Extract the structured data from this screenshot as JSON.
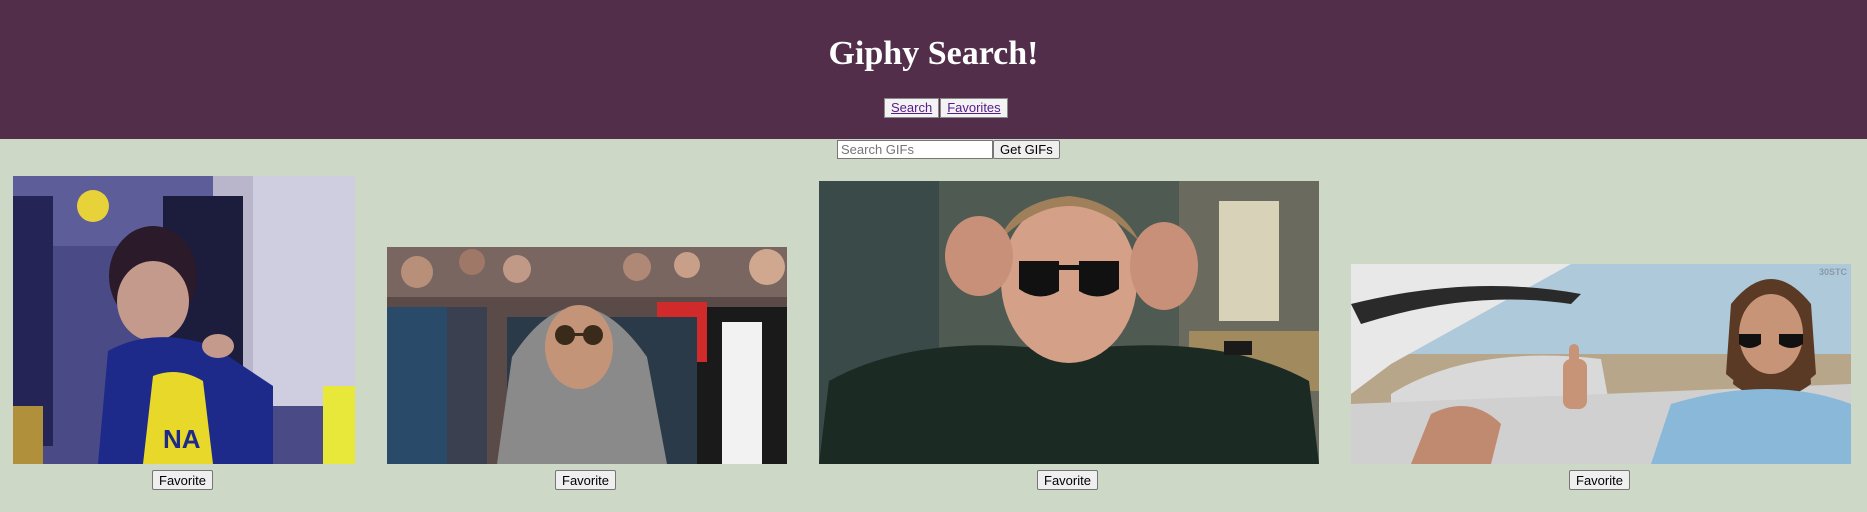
{
  "header": {
    "title": "Giphy Search!",
    "nav": [
      {
        "label": "Search"
      },
      {
        "label": "Favorites"
      }
    ]
  },
  "search": {
    "placeholder": "Search GIFs",
    "value": "",
    "button_label": "Get GIFs"
  },
  "results": [
    {
      "alt": "boy in Pacers jersey pointing at the crowd",
      "favorite_label": "Favorite"
    },
    {
      "alt": "woman in grey hoodie and aviator sunglasses in audience",
      "favorite_label": "Favorite"
    },
    {
      "alt": "young man putting on black sunglasses",
      "favorite_label": "Favorite"
    },
    {
      "alt": "bearded man in convertible giving thumbs up",
      "favorite_label": "Favorite",
      "watermark": "30STC"
    }
  ],
  "colors": {
    "header_bg": "#522e4b",
    "page_bg": "#cdd9c6",
    "link": "#551a8b"
  }
}
